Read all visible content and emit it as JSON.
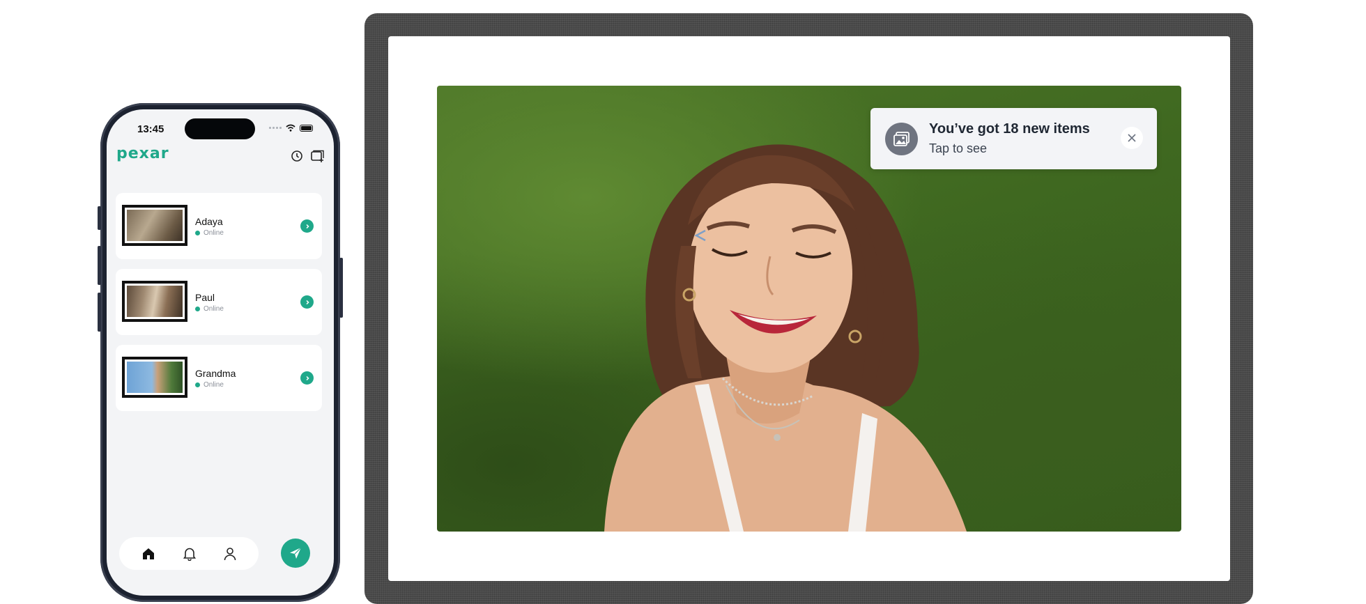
{
  "phone": {
    "status_time": "13:45",
    "app_logo": "pexar",
    "header_icons": [
      "history-icon",
      "add-frame-icon"
    ],
    "contacts": [
      {
        "name": "Adaya",
        "status": "Online"
      },
      {
        "name": "Paul",
        "status": "Online"
      },
      {
        "name": "Grandma",
        "status": "Online"
      }
    ],
    "nav": [
      "home-icon",
      "bell-icon",
      "user-icon"
    ],
    "accent_color": "#1fa88a"
  },
  "frame": {
    "notification": {
      "title": "You’ve got 18 new items",
      "subtitle": "Tap to see"
    }
  }
}
